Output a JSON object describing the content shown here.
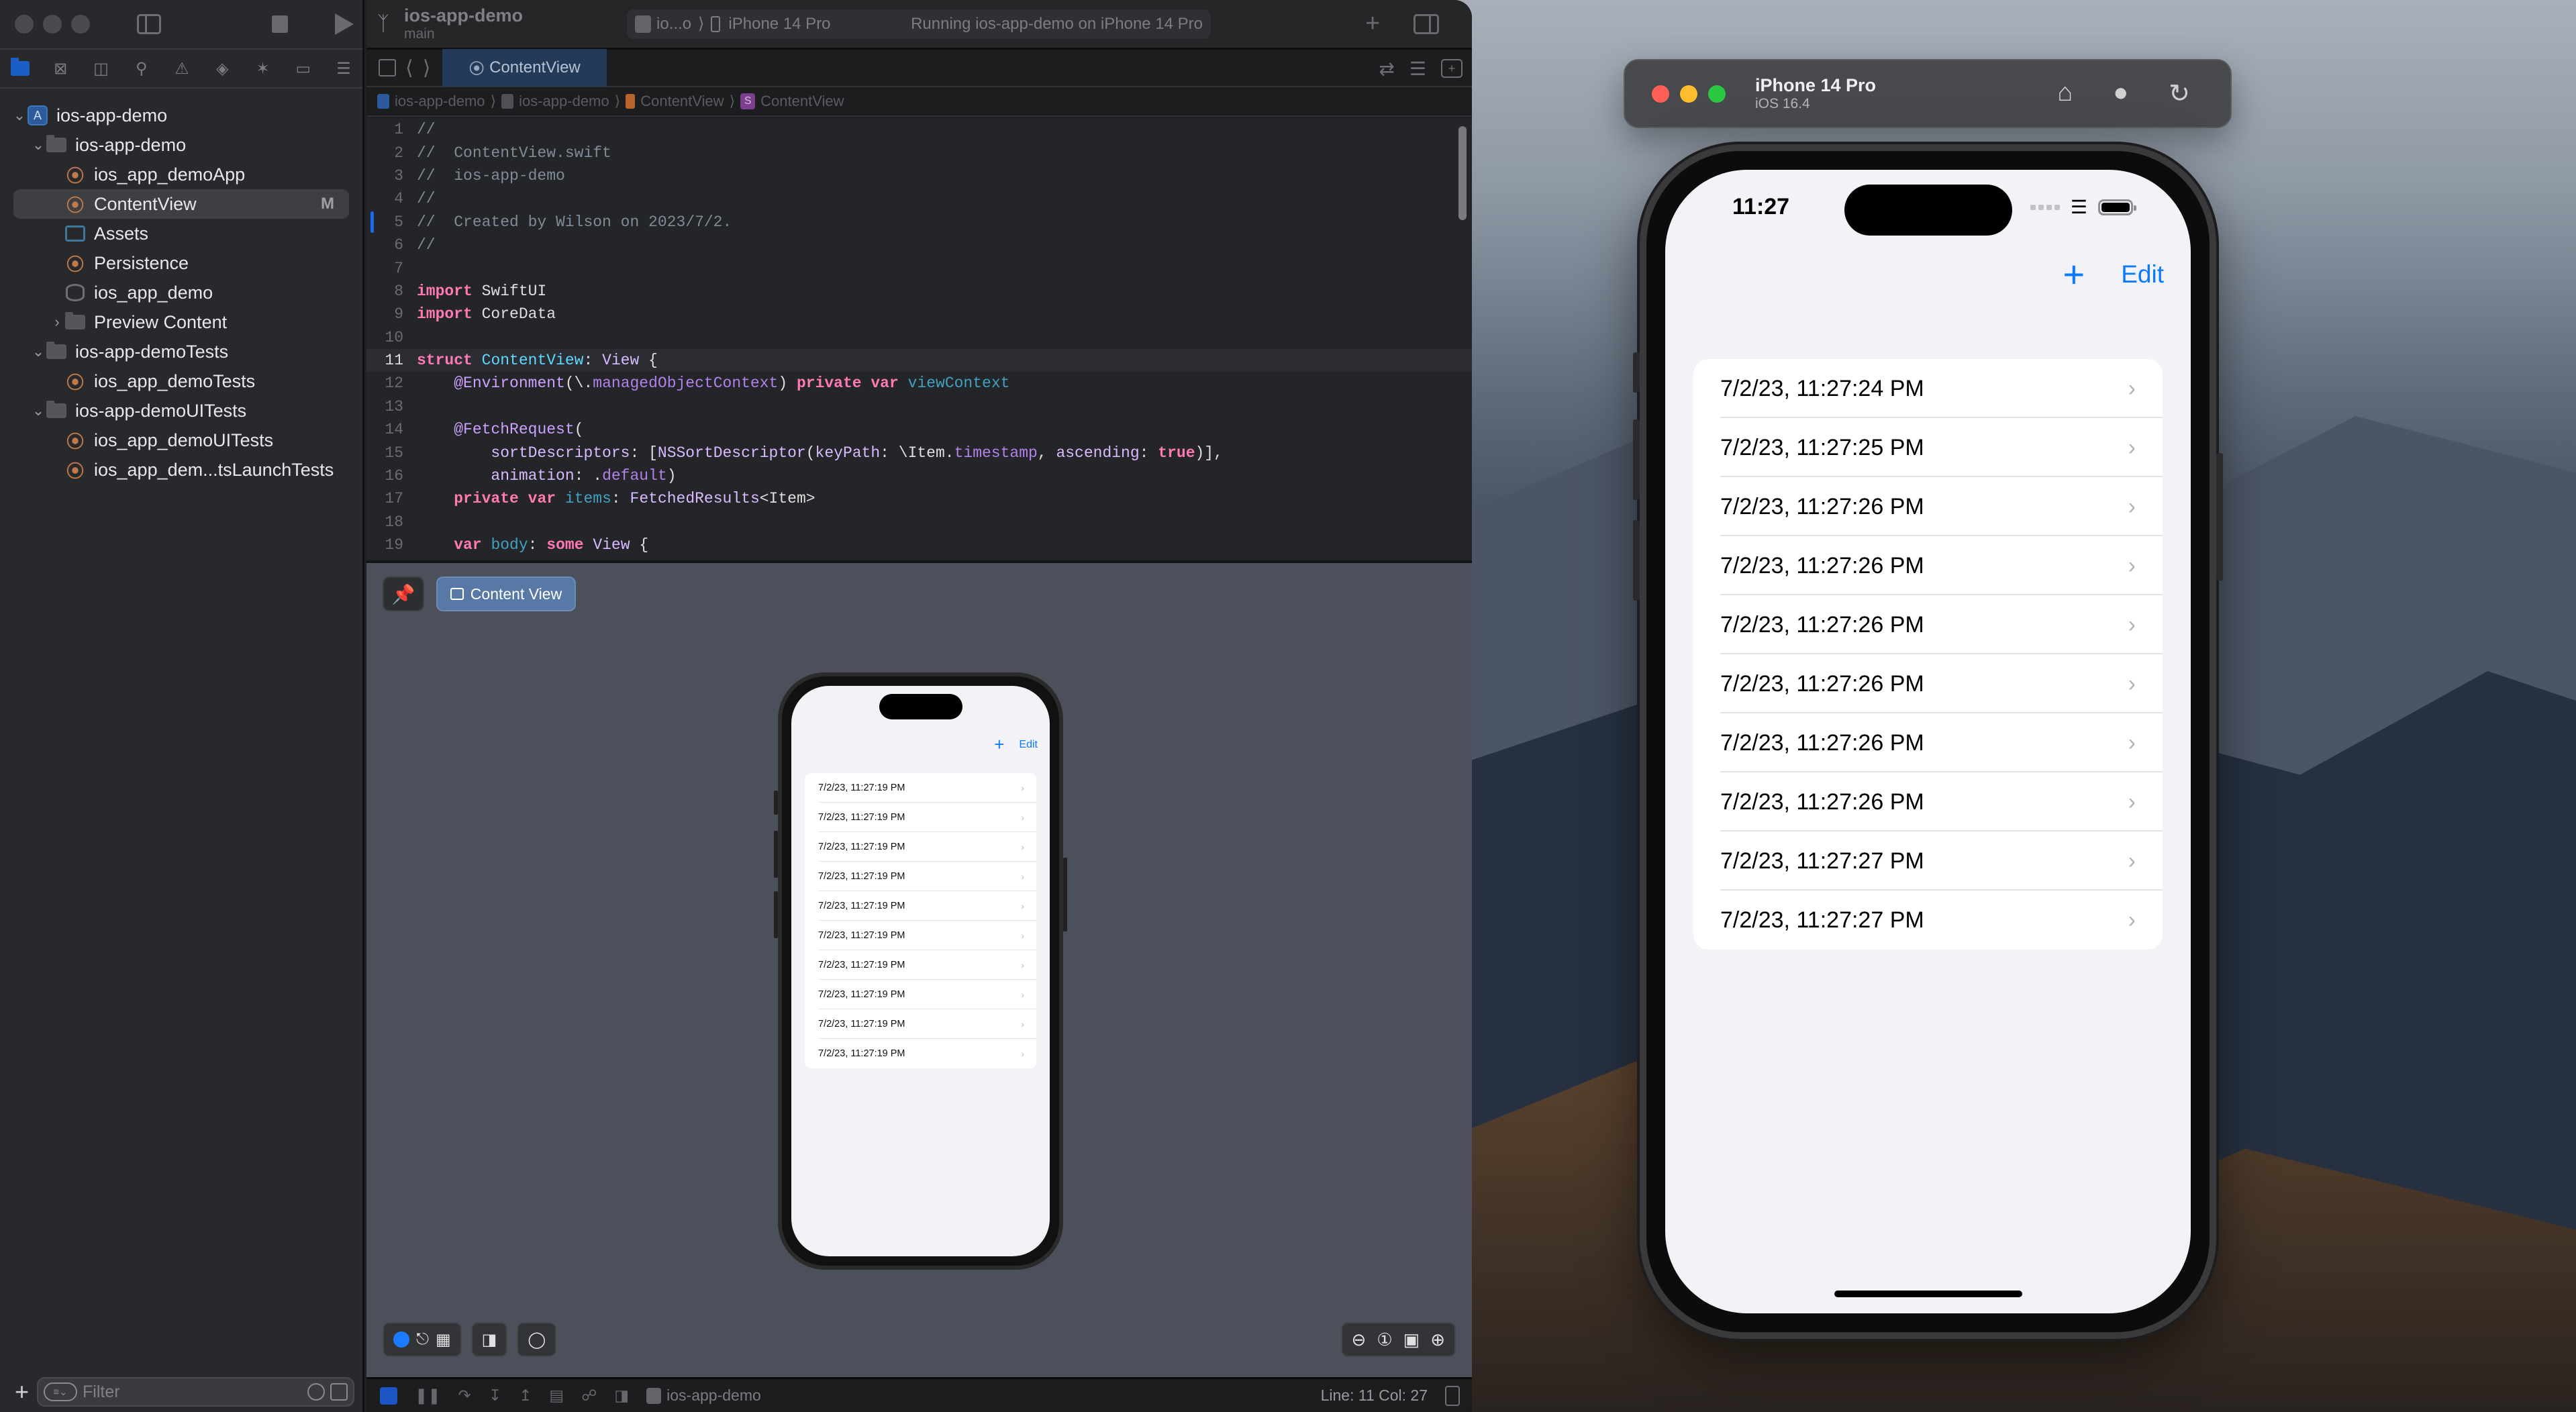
{
  "xcode": {
    "project_name": "ios-app-demo",
    "branch": "main",
    "scheme": {
      "app_short": "io...o",
      "device": "iPhone 14 Pro",
      "status": "Running ios-app-demo on iPhone 14 Pro"
    },
    "navigator_icons": [
      "folder-icon",
      "source-control-icon",
      "symbol-hierarchy-icon",
      "find-icon",
      "issue-warning-icon",
      "test-diamond-icon",
      "debug-spray-icon",
      "breakpoint-tag-icon",
      "report-list-icon"
    ],
    "tree": [
      {
        "label": "ios-app-demo",
        "kind": "project",
        "expanded": true,
        "depth": 0
      },
      {
        "label": "ios-app-demo",
        "kind": "folder",
        "expanded": true,
        "depth": 1
      },
      {
        "label": "ios_app_demoApp",
        "kind": "swift",
        "depth": 2
      },
      {
        "label": "ContentView",
        "kind": "swift",
        "depth": 2,
        "selected": true,
        "badge": "M"
      },
      {
        "label": "Assets",
        "kind": "assets",
        "depth": 2
      },
      {
        "label": "Persistence",
        "kind": "swift",
        "depth": 2
      },
      {
        "label": "ios_app_demo",
        "kind": "datamodel",
        "depth": 2
      },
      {
        "label": "Preview Content",
        "kind": "folder",
        "expanded": false,
        "depth": 2
      },
      {
        "label": "ios-app-demoTests",
        "kind": "folder",
        "expanded": true,
        "depth": 1
      },
      {
        "label": "ios_app_demoTests",
        "kind": "swift",
        "depth": 2
      },
      {
        "label": "ios-app-demoUITests",
        "kind": "folder",
        "expanded": true,
        "depth": 1
      },
      {
        "label": "ios_app_demoUITests",
        "kind": "swift",
        "depth": 2
      },
      {
        "label": "ios_app_dem...tsLaunchTests",
        "kind": "swift",
        "depth": 2
      }
    ],
    "filter_placeholder": "Filter",
    "active_tab": "ContentView",
    "breadcrumb": [
      "ios-app-demo",
      "ios-app-demo",
      "ContentView",
      "ContentView"
    ],
    "current_line": 11,
    "changed_line": 5,
    "code": [
      [
        {
          "t": "//",
          "c": "comment"
        }
      ],
      [
        {
          "t": "//  ContentView.swift",
          "c": "comment"
        }
      ],
      [
        {
          "t": "//  ios-app-demo",
          "c": "comment"
        }
      ],
      [
        {
          "t": "//",
          "c": "comment"
        }
      ],
      [
        {
          "t": "//  Created by Wilson on 2023/7/2.",
          "c": "comment"
        }
      ],
      [
        {
          "t": "//",
          "c": "comment"
        }
      ],
      [],
      [
        {
          "t": "import",
          "c": "kw"
        },
        {
          "t": " SwiftUI",
          "c": "plain"
        }
      ],
      [
        {
          "t": "import",
          "c": "kw"
        },
        {
          "t": " CoreData",
          "c": "plain"
        }
      ],
      [],
      [
        {
          "t": "struct",
          "c": "kw"
        },
        {
          "t": " ",
          "c": "plain"
        },
        {
          "t": "ContentView",
          "c": "type"
        },
        {
          "t": ": ",
          "c": "plain"
        },
        {
          "t": "View",
          "c": "other"
        },
        {
          "t": " {",
          "c": "plain"
        }
      ],
      [
        {
          "t": "    ",
          "c": "plain"
        },
        {
          "t": "@Environment",
          "c": "attr"
        },
        {
          "t": "(\\.",
          "c": "plain"
        },
        {
          "t": "managedObjectContext",
          "c": "prop"
        },
        {
          "t": ") ",
          "c": "plain"
        },
        {
          "t": "private",
          "c": "kw"
        },
        {
          "t": " ",
          "c": "plain"
        },
        {
          "t": "var",
          "c": "kw"
        },
        {
          "t": " ",
          "c": "plain"
        },
        {
          "t": "viewContext",
          "c": "var"
        }
      ],
      [],
      [
        {
          "t": "    ",
          "c": "plain"
        },
        {
          "t": "@FetchRequest",
          "c": "attr"
        },
        {
          "t": "(",
          "c": "plain"
        }
      ],
      [
        {
          "t": "        ",
          "c": "plain"
        },
        {
          "t": "sortDescriptors",
          "c": "other"
        },
        {
          "t": ": [",
          "c": "plain"
        },
        {
          "t": "NSSortDescriptor",
          "c": "other"
        },
        {
          "t": "(",
          "c": "plain"
        },
        {
          "t": "keyPath",
          "c": "other"
        },
        {
          "t": ": \\Item.",
          "c": "plain"
        },
        {
          "t": "timestamp",
          "c": "prop"
        },
        {
          "t": ", ",
          "c": "plain"
        },
        {
          "t": "ascending",
          "c": "other"
        },
        {
          "t": ": ",
          "c": "plain"
        },
        {
          "t": "true",
          "c": "kw"
        },
        {
          "t": ")],",
          "c": "plain"
        }
      ],
      [
        {
          "t": "        ",
          "c": "plain"
        },
        {
          "t": "animation",
          "c": "other"
        },
        {
          "t": ": .",
          "c": "plain"
        },
        {
          "t": "default",
          "c": "prop"
        },
        {
          "t": ")",
          "c": "plain"
        }
      ],
      [
        {
          "t": "    ",
          "c": "plain"
        },
        {
          "t": "private",
          "c": "kw"
        },
        {
          "t": " ",
          "c": "plain"
        },
        {
          "t": "var",
          "c": "kw"
        },
        {
          "t": " ",
          "c": "plain"
        },
        {
          "t": "items",
          "c": "var"
        },
        {
          "t": ": ",
          "c": "plain"
        },
        {
          "t": "FetchedResults",
          "c": "other"
        },
        {
          "t": "<Item>",
          "c": "plain"
        }
      ],
      [],
      [
        {
          "t": "    ",
          "c": "plain"
        },
        {
          "t": "var",
          "c": "kw"
        },
        {
          "t": " ",
          "c": "plain"
        },
        {
          "t": "body",
          "c": "var"
        },
        {
          "t": ": ",
          "c": "plain"
        },
        {
          "t": "some",
          "c": "kw"
        },
        {
          "t": " ",
          "c": "plain"
        },
        {
          "t": "View",
          "c": "other"
        },
        {
          "t": " {",
          "c": "plain"
        }
      ]
    ],
    "preview": {
      "selector_label": "Content View",
      "nav_plus": "+",
      "nav_edit": "Edit",
      "rows": [
        "7/2/23, 11:27:19 PM",
        "7/2/23, 11:27:19 PM",
        "7/2/23, 11:27:19 PM",
        "7/2/23, 11:27:19 PM",
        "7/2/23, 11:27:19 PM",
        "7/2/23, 11:27:19 PM",
        "7/2/23, 11:27:19 PM",
        "7/2/23, 11:27:19 PM",
        "7/2/23, 11:27:19 PM",
        "7/2/23, 11:27:19 PM"
      ]
    },
    "statusbar": {
      "target": "ios-app-demo",
      "line_col": "Line: 11  Col: 27"
    }
  },
  "simulator": {
    "device_name": "iPhone 14 Pro",
    "os_version": "iOS 16.4",
    "light_colors": [
      "#ff5f57",
      "#febc2e",
      "#28c840"
    ],
    "status_time": "11:27",
    "nav_plus": "+",
    "nav_edit": "Edit",
    "accent_color": "#0a7aff",
    "rows": [
      "7/2/23, 11:27:24 PM",
      "7/2/23, 11:27:25 PM",
      "7/2/23, 11:27:26 PM",
      "7/2/23, 11:27:26 PM",
      "7/2/23, 11:27:26 PM",
      "7/2/23, 11:27:26 PM",
      "7/2/23, 11:27:26 PM",
      "7/2/23, 11:27:26 PM",
      "7/2/23, 11:27:27 PM",
      "7/2/23, 11:27:27 PM"
    ]
  }
}
